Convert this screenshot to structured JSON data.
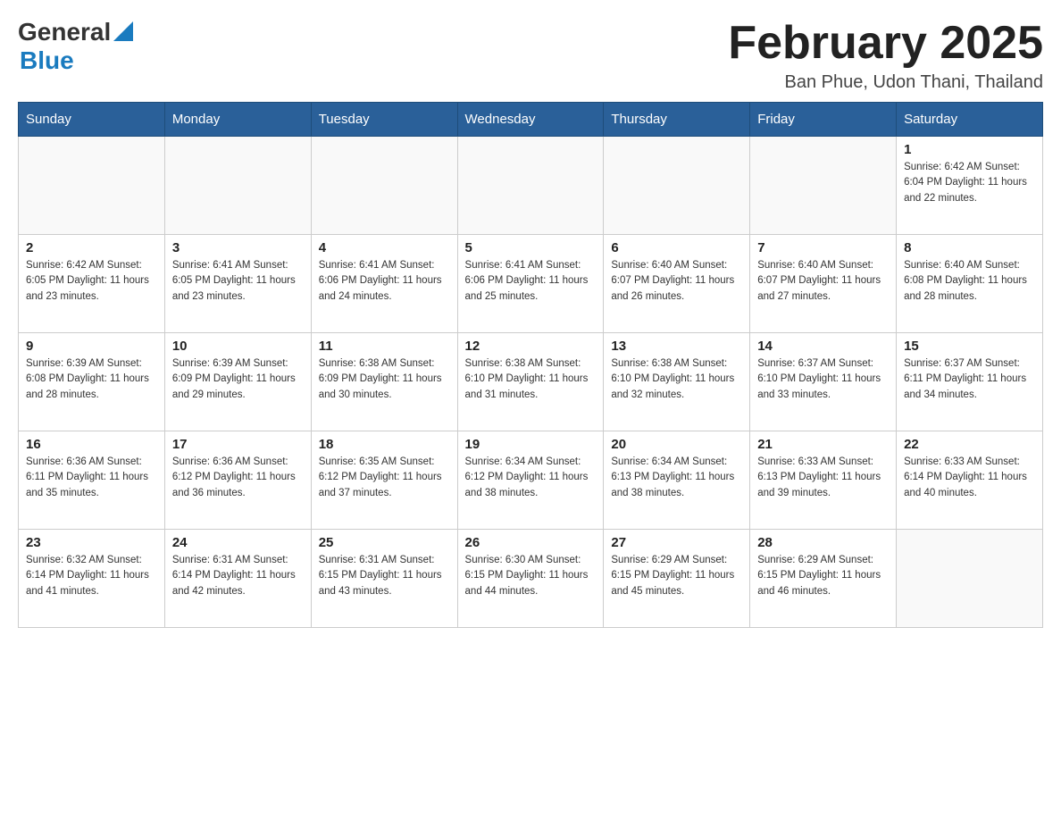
{
  "header": {
    "logo": {
      "general": "General",
      "blue": "Blue",
      "triangle_color": "#1a7bbf"
    },
    "title": "February 2025",
    "location": "Ban Phue, Udon Thani, Thailand"
  },
  "days_of_week": [
    "Sunday",
    "Monday",
    "Tuesday",
    "Wednesday",
    "Thursday",
    "Friday",
    "Saturday"
  ],
  "weeks": [
    {
      "days": [
        {
          "date": "",
          "info": ""
        },
        {
          "date": "",
          "info": ""
        },
        {
          "date": "",
          "info": ""
        },
        {
          "date": "",
          "info": ""
        },
        {
          "date": "",
          "info": ""
        },
        {
          "date": "",
          "info": ""
        },
        {
          "date": "1",
          "info": "Sunrise: 6:42 AM\nSunset: 6:04 PM\nDaylight: 11 hours\nand 22 minutes."
        }
      ]
    },
    {
      "days": [
        {
          "date": "2",
          "info": "Sunrise: 6:42 AM\nSunset: 6:05 PM\nDaylight: 11 hours\nand 23 minutes."
        },
        {
          "date": "3",
          "info": "Sunrise: 6:41 AM\nSunset: 6:05 PM\nDaylight: 11 hours\nand 23 minutes."
        },
        {
          "date": "4",
          "info": "Sunrise: 6:41 AM\nSunset: 6:06 PM\nDaylight: 11 hours\nand 24 minutes."
        },
        {
          "date": "5",
          "info": "Sunrise: 6:41 AM\nSunset: 6:06 PM\nDaylight: 11 hours\nand 25 minutes."
        },
        {
          "date": "6",
          "info": "Sunrise: 6:40 AM\nSunset: 6:07 PM\nDaylight: 11 hours\nand 26 minutes."
        },
        {
          "date": "7",
          "info": "Sunrise: 6:40 AM\nSunset: 6:07 PM\nDaylight: 11 hours\nand 27 minutes."
        },
        {
          "date": "8",
          "info": "Sunrise: 6:40 AM\nSunset: 6:08 PM\nDaylight: 11 hours\nand 28 minutes."
        }
      ]
    },
    {
      "days": [
        {
          "date": "9",
          "info": "Sunrise: 6:39 AM\nSunset: 6:08 PM\nDaylight: 11 hours\nand 28 minutes."
        },
        {
          "date": "10",
          "info": "Sunrise: 6:39 AM\nSunset: 6:09 PM\nDaylight: 11 hours\nand 29 minutes."
        },
        {
          "date": "11",
          "info": "Sunrise: 6:38 AM\nSunset: 6:09 PM\nDaylight: 11 hours\nand 30 minutes."
        },
        {
          "date": "12",
          "info": "Sunrise: 6:38 AM\nSunset: 6:10 PM\nDaylight: 11 hours\nand 31 minutes."
        },
        {
          "date": "13",
          "info": "Sunrise: 6:38 AM\nSunset: 6:10 PM\nDaylight: 11 hours\nand 32 minutes."
        },
        {
          "date": "14",
          "info": "Sunrise: 6:37 AM\nSunset: 6:10 PM\nDaylight: 11 hours\nand 33 minutes."
        },
        {
          "date": "15",
          "info": "Sunrise: 6:37 AM\nSunset: 6:11 PM\nDaylight: 11 hours\nand 34 minutes."
        }
      ]
    },
    {
      "days": [
        {
          "date": "16",
          "info": "Sunrise: 6:36 AM\nSunset: 6:11 PM\nDaylight: 11 hours\nand 35 minutes."
        },
        {
          "date": "17",
          "info": "Sunrise: 6:36 AM\nSunset: 6:12 PM\nDaylight: 11 hours\nand 36 minutes."
        },
        {
          "date": "18",
          "info": "Sunrise: 6:35 AM\nSunset: 6:12 PM\nDaylight: 11 hours\nand 37 minutes."
        },
        {
          "date": "19",
          "info": "Sunrise: 6:34 AM\nSunset: 6:12 PM\nDaylight: 11 hours\nand 38 minutes."
        },
        {
          "date": "20",
          "info": "Sunrise: 6:34 AM\nSunset: 6:13 PM\nDaylight: 11 hours\nand 38 minutes."
        },
        {
          "date": "21",
          "info": "Sunrise: 6:33 AM\nSunset: 6:13 PM\nDaylight: 11 hours\nand 39 minutes."
        },
        {
          "date": "22",
          "info": "Sunrise: 6:33 AM\nSunset: 6:14 PM\nDaylight: 11 hours\nand 40 minutes."
        }
      ]
    },
    {
      "days": [
        {
          "date": "23",
          "info": "Sunrise: 6:32 AM\nSunset: 6:14 PM\nDaylight: 11 hours\nand 41 minutes."
        },
        {
          "date": "24",
          "info": "Sunrise: 6:31 AM\nSunset: 6:14 PM\nDaylight: 11 hours\nand 42 minutes."
        },
        {
          "date": "25",
          "info": "Sunrise: 6:31 AM\nSunset: 6:15 PM\nDaylight: 11 hours\nand 43 minutes."
        },
        {
          "date": "26",
          "info": "Sunrise: 6:30 AM\nSunset: 6:15 PM\nDaylight: 11 hours\nand 44 minutes."
        },
        {
          "date": "27",
          "info": "Sunrise: 6:29 AM\nSunset: 6:15 PM\nDaylight: 11 hours\nand 45 minutes."
        },
        {
          "date": "28",
          "info": "Sunrise: 6:29 AM\nSunset: 6:15 PM\nDaylight: 11 hours\nand 46 minutes."
        },
        {
          "date": "",
          "info": ""
        }
      ]
    }
  ]
}
